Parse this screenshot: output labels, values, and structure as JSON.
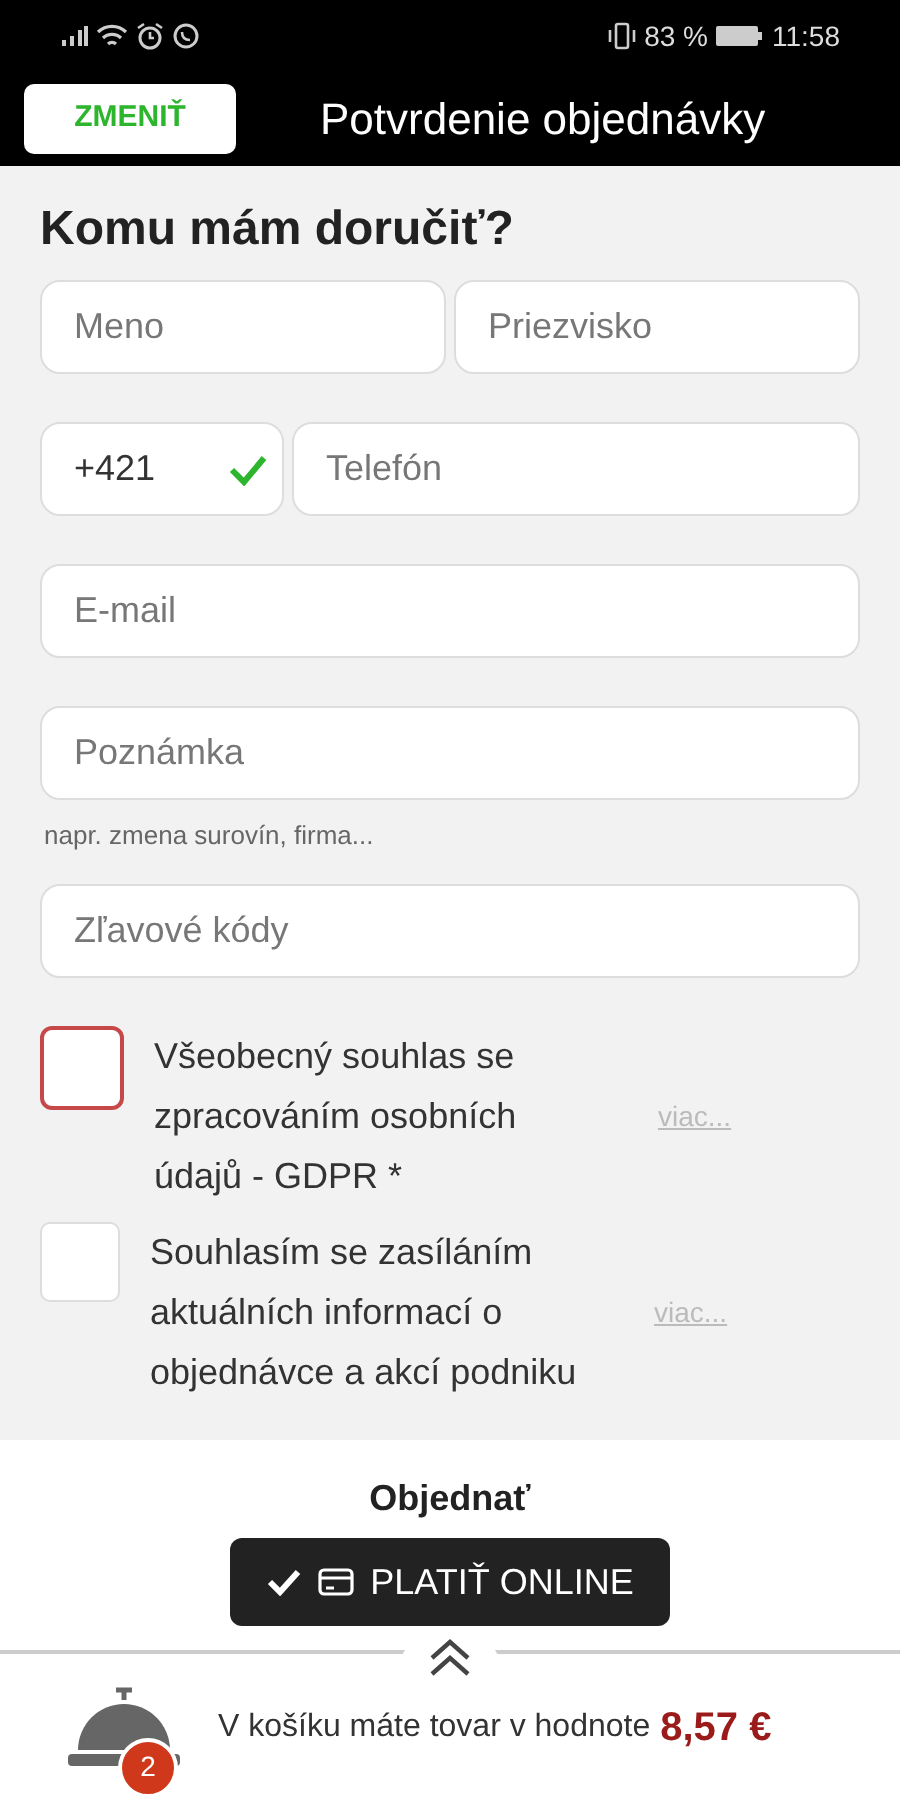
{
  "status_bar": {
    "battery": "83 %",
    "time": "11:58"
  },
  "header": {
    "back_button": "ZMENIŤ",
    "title": "Potvrdenie objednávky"
  },
  "form": {
    "heading": "Komu mám doručiť?",
    "first_name": {
      "placeholder": "Meno"
    },
    "last_name": {
      "placeholder": "Priezvisko"
    },
    "phone_prefix": {
      "value": "+421",
      "valid": true
    },
    "phone": {
      "placeholder": "Telefón"
    },
    "email": {
      "placeholder": "E-mail"
    },
    "note": {
      "placeholder": "Poznámka",
      "hint": "napr. zmena surovín, firma..."
    },
    "discount": {
      "placeholder": "Zľavové kódy"
    }
  },
  "consents": [
    {
      "label": "Všeobecný souhlas se zpracováním osobních údajů - GDPR *",
      "more": "viac...",
      "checked": false,
      "error": true
    },
    {
      "label": "Souhlasím se zasíláním aktuálních informací o objednávce a akcí podniku",
      "more": "viac...",
      "checked": false,
      "error": false
    }
  ],
  "order": {
    "title": "Objednať",
    "pay_button": "PLATIŤ ONLINE"
  },
  "cart": {
    "count": "2",
    "text": "V košíku máte tovar v hodnote",
    "total": "8,57 €"
  }
}
